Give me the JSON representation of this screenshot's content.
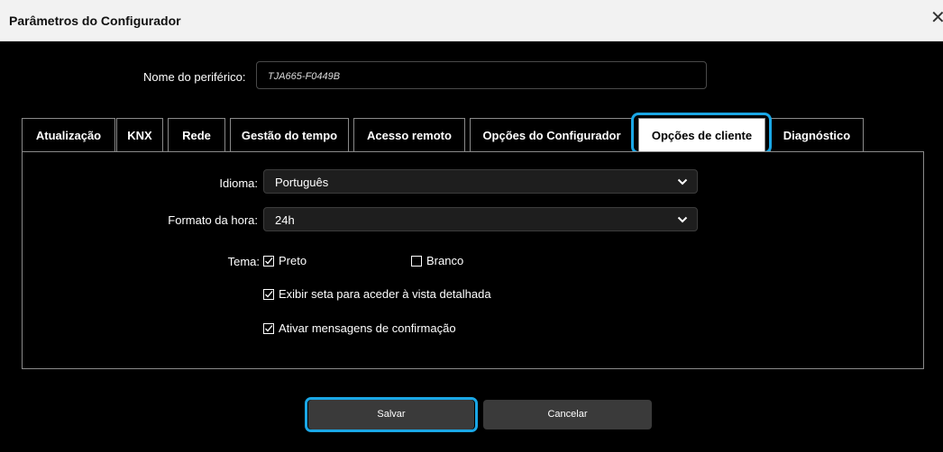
{
  "window": {
    "title": "Parâmetros do Configurador",
    "close_glyph": "✕"
  },
  "device": {
    "label": "Nome do periférico:",
    "value": "TJA665-F0449B"
  },
  "tabs": [
    {
      "label": "Atualização",
      "active": false
    },
    {
      "label": "KNX",
      "active": false
    },
    {
      "label": "Rede",
      "active": false
    },
    {
      "label": "Gestão do tempo",
      "active": false
    },
    {
      "label": "Acesso remoto",
      "active": false
    },
    {
      "label": "Opções do Configurador",
      "active": false
    },
    {
      "label": "Opções de cliente",
      "active": true
    },
    {
      "label": "Diagnóstico",
      "active": false
    }
  ],
  "client_options": {
    "language": {
      "label": "Idioma:",
      "value": "Português"
    },
    "time_format": {
      "label": "Formato da hora:",
      "value": "24h"
    },
    "theme": {
      "label": "Tema:",
      "options": [
        {
          "label": "Preto",
          "checked": true
        },
        {
          "label": "Branco",
          "checked": false
        }
      ]
    },
    "show_arrow": {
      "label": "Exibir seta para aceder à vista detalhada",
      "checked": true
    },
    "confirm_messages": {
      "label": "Ativar mensagens de confirmação",
      "checked": true
    }
  },
  "buttons": {
    "save": "Salvar",
    "cancel": "Cancelar"
  },
  "colors": {
    "highlight": "#1aa7e6",
    "background": "#000000",
    "titlebar": "#f2f2f2",
    "button": "#3a3a3a"
  },
  "icons": {
    "dropdown": "chevron-down-icon",
    "checked": "checkbox-checked-icon",
    "unchecked": "checkbox-unchecked-icon",
    "close": "close-icon"
  }
}
